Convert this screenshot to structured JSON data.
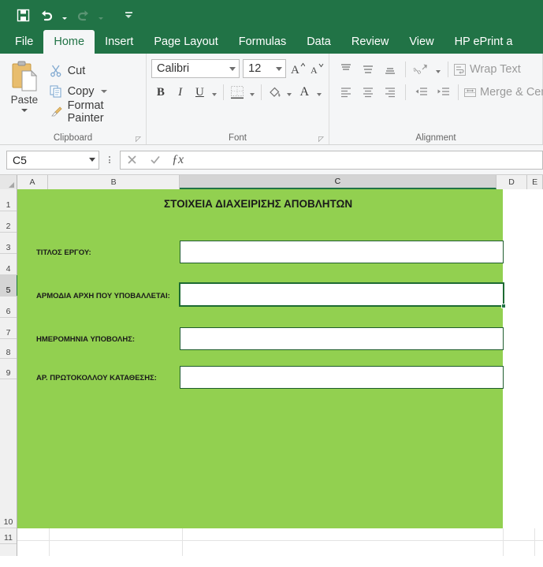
{
  "quick_access": {
    "buttons": [
      {
        "name": "save-button",
        "icon": "save-icon",
        "label": "Save",
        "enabled": true
      },
      {
        "name": "undo-button",
        "icon": "undo-icon",
        "label": "Undo",
        "enabled": true
      },
      {
        "name": "redo-button",
        "icon": "redo-icon",
        "label": "Redo",
        "enabled": false
      },
      {
        "name": "customize-qat-button",
        "icon": "customize-toolbar-icon",
        "label": "Customize Quick Access Toolbar",
        "enabled": true
      }
    ]
  },
  "ribbon": {
    "tabs": [
      {
        "label": "File",
        "active": false
      },
      {
        "label": "Home",
        "active": true
      },
      {
        "label": "Insert",
        "active": false
      },
      {
        "label": "Page Layout",
        "active": false
      },
      {
        "label": "Formulas",
        "active": false
      },
      {
        "label": "Data",
        "active": false
      },
      {
        "label": "Review",
        "active": false
      },
      {
        "label": "View",
        "active": false
      },
      {
        "label": "HP ePrint a",
        "active": false
      }
    ],
    "groups": {
      "clipboard": {
        "label": "Clipboard",
        "paste_label": "Paste",
        "items": [
          {
            "label": "Cut",
            "icon": "scissors-icon",
            "has_dropdown": false
          },
          {
            "label": "Copy",
            "icon": "copy-icon",
            "has_dropdown": true
          },
          {
            "label": "Format Painter",
            "icon": "paintbrush-icon",
            "has_dropdown": false
          }
        ]
      },
      "font": {
        "label": "Font",
        "font_name": "Calibri",
        "font_size": "12",
        "grow_font_label": "A",
        "shrink_font_label": "A",
        "bold_label": "B",
        "italic_label": "I",
        "underline_label": "U",
        "borders_icon": "borders-icon",
        "fill_color_icon": "fill-color-icon",
        "font_color_label": "A"
      },
      "alignment": {
        "label": "Alignment",
        "wrap_text_label": "Wrap Text",
        "merge_center_label": "Merge & Cen",
        "icons": [
          "align-top-icon",
          "align-middle-icon",
          "align-bottom-icon",
          "orientation-icon",
          "align-left-icon",
          "align-center-icon",
          "align-right-icon",
          "decrease-indent-icon",
          "increase-indent-icon"
        ]
      }
    }
  },
  "formula_bar": {
    "name_box_value": "C5",
    "cancel_icon": "cancel-icon",
    "enter_icon": "check-icon",
    "function_icon": "insert-function-icon",
    "formula_value": ""
  },
  "grid": {
    "columns": [
      {
        "label": "A",
        "selected": false
      },
      {
        "label": "B",
        "selected": false
      },
      {
        "label": "C",
        "selected": true
      },
      {
        "label": "D",
        "selected": false
      },
      {
        "label": "E",
        "selected": false
      }
    ],
    "rows": [
      "1",
      "2",
      "3",
      "4",
      "5",
      "6",
      "7",
      "8",
      "9",
      "10",
      "11"
    ],
    "selected_row": "5",
    "active_cell": "C5",
    "fill_color": "#92d050",
    "selection_border_color": "#1e6b33",
    "sheet_title": "ΣΤΟΙΧΕΙΑ ΔΙΑΧΕΙΡΙΣΗΣ ΑΠΟΒΛΗΤΩΝ",
    "fields": [
      {
        "label": "ΤΙΤΛΟΣ ΕΡΓΟΥ:",
        "value": "",
        "active": false
      },
      {
        "label": "ΑΡΜΟΔΙΑ ΑΡΧΗ ΠΟΥ ΥΠΟΒΑΛΛΕΤΑΙ:",
        "value": "",
        "active": true
      },
      {
        "label": "ΗΜΕΡΟΜΗΝΙΑ ΥΠΟΒΟΛΗΣ:",
        "value": "",
        "active": false
      },
      {
        "label": "ΑΡ. ΠΡΩΤΟΚΟΛΛΟΥ ΚΑΤΑΘΕΣΗΣ:",
        "value": "",
        "active": false
      }
    ]
  }
}
